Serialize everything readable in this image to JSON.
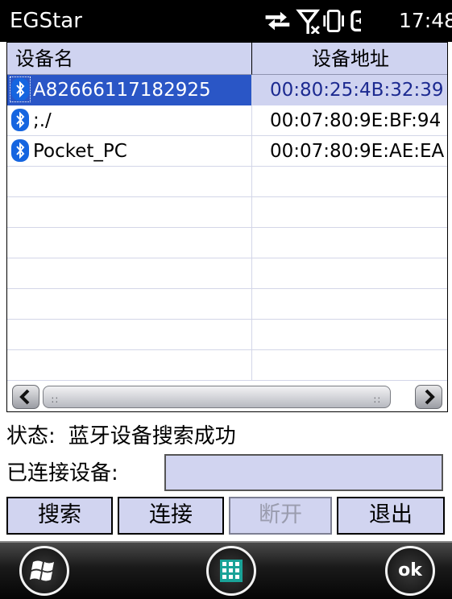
{
  "statusbar": {
    "title": "EGStar",
    "time": "17:48",
    "icons": [
      "sync-arrows-icon",
      "no-signal-icon",
      "vibrate-icon",
      "battery-charging-icon"
    ]
  },
  "devices": {
    "columns": [
      "设备名",
      "设备地址"
    ],
    "rows": [
      {
        "name": "A82666117182925",
        "address": "00:80:25:4B:32:39",
        "selected": true
      },
      {
        "name": ";./",
        "address": "00:07:80:9E:BF:94",
        "selected": false
      },
      {
        "name": "Pocket_PC",
        "address": "00:07:80:9E:AE:EA",
        "selected": false
      }
    ],
    "row_icon": "bluetooth-icon"
  },
  "status": {
    "label": "状态:",
    "message": "蓝牙设备搜索成功"
  },
  "connected": {
    "label": "已连接设备:",
    "value": ""
  },
  "buttons": {
    "search": "搜索",
    "connect": "连接",
    "disconnect": "断开",
    "exit": "退出"
  },
  "bottombar": {
    "start_icon": "windows-start-icon",
    "keyboard_icon": "keyboard-icon",
    "ok_label": "ok"
  },
  "colors": {
    "selection": "#2a56c6",
    "panel": "#d1d4f0",
    "header": "#cfd3f0"
  }
}
